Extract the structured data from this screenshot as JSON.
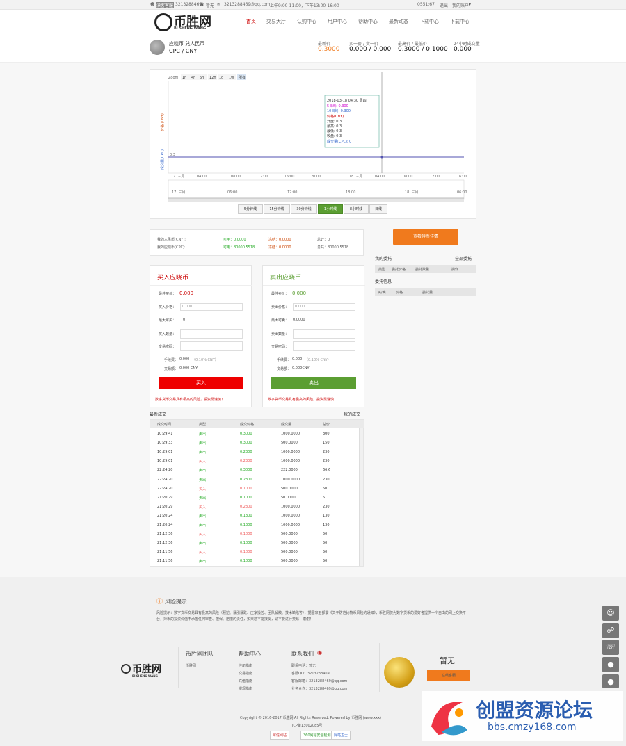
{
  "topbar": {
    "qq_label": "漂客客服",
    "qq_number": "3213288469",
    "phone": "暂无",
    "email": "3213288469@qq.com",
    "hours": "上午9:00-11:00，下午13:00-16:00",
    "account": "0551:67",
    "logout": "退出",
    "my_account": "我的账户"
  },
  "logo": {
    "text": "币胜网",
    "sub": "BI SHENG WANG"
  },
  "nav": [
    "首页",
    "交易大厅",
    "认购中心",
    "用户中心",
    "帮助中心",
    "最新动态",
    "下载中心",
    "下载中心"
  ],
  "pair": {
    "name": "应晓币 兑人民币",
    "code": "CPC / CNY",
    "latest_label": "最新价",
    "latest_value": "0.3000",
    "buysell_label": "买一价 / 卖一价",
    "buysell_value": "0.000 / 0.000",
    "highlow_label": "最高价 / 最低价",
    "highlow_value": "0.3000 / 0.1000",
    "volume_label": "24小时成交量",
    "volume_value": "0.000"
  },
  "chart": {
    "zoom_label": "Zoom",
    "zoom_opts": [
      "1h",
      "4h",
      "6h",
      "12h",
      "1d",
      "1w",
      "所有"
    ],
    "y_label_top": "价格 (CNY)",
    "y_label_bottom": "成交量(CPC)",
    "x_ticks": [
      "17. 三月",
      "04:00",
      "08:00",
      "12:00",
      "16:00",
      "20:00",
      "18. 三月",
      "04:00",
      "08:00",
      "12:00",
      "16:00"
    ],
    "nav_ticks": [
      "17. 三月",
      "06:00",
      "12:00",
      "18:00",
      "18. 三月",
      "06:00"
    ],
    "y_tick": "0.3",
    "tooltip": {
      "date": "2018-03-18 04:30 周四",
      "ma5": "5日均: 0.300",
      "ma10": "10日均: 0.300",
      "price_header": "价格(CNY)",
      "open": "开盘: 0.3",
      "high": "最高: 0.3",
      "low": "最低: 0.3",
      "close": "收盘: 0.3",
      "vol": "成交量(CPC): 0"
    },
    "periods": [
      "5分钟线",
      "15分钟线",
      "30分钟线",
      "1小时线",
      "8小时线",
      "日线"
    ],
    "active_period": "1小时线",
    "chart_data": {
      "type": "line",
      "series": [
        {
          "name": "价格(CNY)",
          "values": [
            0.3,
            0.3,
            0.3,
            0.3,
            0.3,
            0.3,
            0.3,
            0.3,
            0.3,
            0.3,
            0.3
          ]
        }
      ],
      "categories": [
        "17. 三月",
        "04:00",
        "08:00",
        "12:00",
        "16:00",
        "20:00",
        "18. 三月",
        "04:00",
        "08:00",
        "12:00",
        "16:00"
      ]
    }
  },
  "account_info": {
    "l1": "我的人民币(CNY):",
    "l2": "我的应晓币(CPC):",
    "avail1": "可用：0.0000",
    "frozen1": "冻结：0.0000",
    "total1": "总计：0",
    "avail2": "可用：80000.5518",
    "frozen2": "冻结：0.0000",
    "total2": "总共：80000.5518"
  },
  "buy": {
    "title": "买入应晓币",
    "best_label": "最佳买价：",
    "best_value": "0.000",
    "price_label": "买入价格：",
    "price_ph": "0.000",
    "max_label": "最大可买：",
    "max_value": "0",
    "qty_label": "买入数量：",
    "pwd_label": "交易密码：",
    "fee_label": "手续费：",
    "fee_value": "0.000",
    "fee_note": "（0.10% CNY）",
    "total_label": "交易额：",
    "total_value": "0.000 CNY",
    "button": "买入",
    "warn": "数字货币交易具有极高的风险，投资需谨慎！"
  },
  "sell": {
    "title": "卖出应晓币",
    "best_label": "最佳卖价：",
    "best_value": "0.000",
    "price_label": "卖出价格：",
    "price_ph": "0.000",
    "max_label": "最大可卖：",
    "max_value": "0.0000",
    "qty_label": "卖出数量：",
    "pwd_label": "交易密码：",
    "fee_label": "手续费：",
    "fee_value": "0.000",
    "fee_note": "（0.10% CNY）",
    "total_label": "交易额：",
    "total_value": "0.000CNY",
    "button": "卖出",
    "warn": "数字货币交易具有极高的风险，投资需谨慎！"
  },
  "trades": {
    "title": "最新成交",
    "mine": "我的成交",
    "headers": [
      "成交时间",
      "类型",
      "成交价格",
      "成交量",
      "总价"
    ],
    "rows": [
      [
        "10:29:41",
        "卖出",
        "0.3000",
        "1000.0000",
        "300"
      ],
      [
        "10:29:33",
        "卖出",
        "0.3000",
        "500.0000",
        "150"
      ],
      [
        "10:29:01",
        "卖出",
        "0.2300",
        "1000.0000",
        "230"
      ],
      [
        "10:29:01",
        "买入",
        "0.2300",
        "1000.0000",
        "230"
      ],
      [
        "22:24:20",
        "卖出",
        "0.3000",
        "222.0000",
        "66.6"
      ],
      [
        "22:24:20",
        "卖出",
        "0.2300",
        "1000.0000",
        "230"
      ],
      [
        "22:24:20",
        "买入",
        "0.1000",
        "500.0000",
        "50"
      ],
      [
        "21:20:29",
        "卖出",
        "0.1000",
        "50.0000",
        "5"
      ],
      [
        "21:20:29",
        "买入",
        "0.2300",
        "1000.0000",
        "230"
      ],
      [
        "21:20:24",
        "卖出",
        "0.1300",
        "1000.0000",
        "130"
      ],
      [
        "21:20:24",
        "卖出",
        "0.1300",
        "1000.0000",
        "130"
      ],
      [
        "21:12:36",
        "买入",
        "0.1000",
        "500.0000",
        "50"
      ],
      [
        "21:12:36",
        "卖出",
        "0.1000",
        "500.0000",
        "50"
      ],
      [
        "21:11:56",
        "买入",
        "0.1000",
        "500.0000",
        "50"
      ],
      [
        "21:11:56",
        "卖出",
        "0.1000",
        "500.0000",
        "50"
      ]
    ]
  },
  "side": {
    "view_btn": "查看持币详情",
    "my_orders": "我的委托",
    "all_orders": "全部委托",
    "orders_headers": [
      "类型",
      "委托价格",
      "委托数量",
      "操作"
    ],
    "depth": "委托信息",
    "depth_headers": [
      "买/卖",
      "价格",
      "委托量"
    ]
  },
  "footer": {
    "risk_title": "风险提示",
    "risk_line1": "风险提示：数字货币交易具有极高的风险（预挖、暴涨暴跌、庄家操控、团队解散、技术缺陷等），据国家五部委《关于防范比特币风险的通知》，币胜网仅为数字货币的爱好者提供一个自由的网上交换平",
    "risk_line2": "台，对币的投资价值不承担任何审查、担保、赔偿的责任，如果您不能接受，请不要进行交易！谢谢！",
    "col1_title": "币胜网团队",
    "col1_items": [
      "币胜网"
    ],
    "col2_title": "帮助中心",
    "col2_items": [
      "注册指南",
      "交易指南",
      "充值指南",
      "提现指南"
    ],
    "col3_title": "联系我们",
    "col3_items": [
      "联系电话：暂无",
      "客服QQ：3213288469",
      "客服邮箱：3213288469@qq.com",
      "业务合作：3213288469@qq.com"
    ],
    "hotline": "暂无",
    "online_btn": "在线客服",
    "copyright": "Copyright © 2016-2017 币胜网 All Rights Reserved. Powered by 币胜网 (www.xxx)",
    "icp": "ICP备13002085号",
    "badges": [
      "可信网站",
      "360网站安全检测",
      "网站卫士"
    ]
  },
  "watermark": {
    "text": "创盟资源论坛",
    "url": "bbs.cmzy168.com"
  }
}
